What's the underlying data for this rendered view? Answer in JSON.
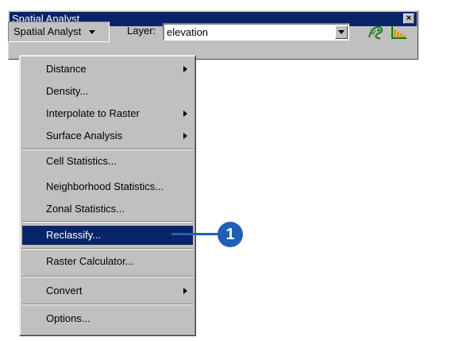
{
  "window": {
    "title": "Spatial Analyst",
    "close_label": "×"
  },
  "toolbar": {
    "menu_button_label": "Spatial Analyst",
    "layer_label": "Layer:",
    "layer_value": "elevation",
    "icons": [
      "histogram-tool-icon",
      "create-histogram-icon"
    ]
  },
  "menu": {
    "items": [
      {
        "label": "Distance",
        "submenu": true
      },
      {
        "label": "Density...",
        "submenu": false
      },
      {
        "label": "Interpolate to Raster",
        "submenu": true
      },
      {
        "label": "Surface Analysis",
        "submenu": true
      },
      {
        "label": "Cell Statistics...",
        "submenu": false
      },
      {
        "label": "Neighborhood Statistics...",
        "submenu": false
      },
      {
        "label": "Zonal Statistics...",
        "submenu": false
      },
      {
        "label": "Reclassify...",
        "submenu": false,
        "highlighted": true
      },
      {
        "label": "Raster Calculator...",
        "submenu": false
      },
      {
        "label": "Convert",
        "submenu": true
      },
      {
        "label": "Options...",
        "submenu": false
      }
    ]
  },
  "callout": {
    "number": "1"
  },
  "colors": {
    "titlebar": "#0a246a",
    "highlight": "#0a246a",
    "callout": "#1f5fb8"
  }
}
